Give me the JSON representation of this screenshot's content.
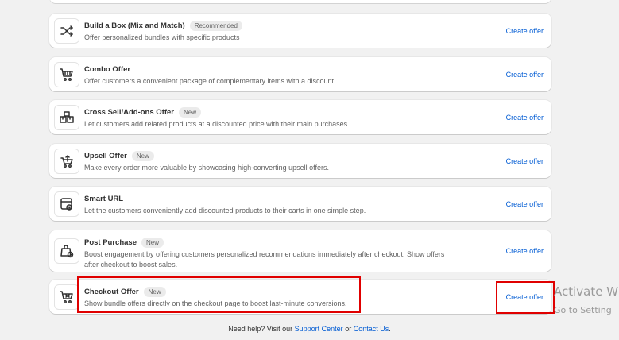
{
  "offers": [
    {
      "title": "Build a Box (Mix and Match)",
      "badge": "Recommended",
      "description": "Offer personalized bundles with specific products",
      "cta": "Create offer",
      "icon": "shuffle-icon"
    },
    {
      "title": "Combo Offer",
      "badge": "",
      "description": "Offer customers a convenient package of complementary items with a discount.",
      "cta": "Create offer",
      "icon": "cart-icon"
    },
    {
      "title": "Cross Sell/Add-ons Offer",
      "badge": "New",
      "description": "Let customers add related products at a discounted price with their main purchases.",
      "cta": "Create offer",
      "icon": "boxes-icon"
    },
    {
      "title": "Upsell Offer",
      "badge": "New",
      "description": "Make every order more valuable by showcasing high-converting upsell offers.",
      "cta": "Create offer",
      "icon": "upsell-cart-icon"
    },
    {
      "title": "Smart URL",
      "badge": "",
      "description": "Let the customers conveniently add discounted products to their carts in one simple step.",
      "cta": "Create offer",
      "icon": "link-window-icon"
    },
    {
      "title": "Post Purchase",
      "badge": "New",
      "description": "Boost engagement by offering customers personalized recommendations immediately after checkout. Show offers after checkout to boost sales.",
      "cta": "Create offer",
      "icon": "bag-clock-icon"
    },
    {
      "title": "Checkout Offer",
      "badge": "New",
      "description": "Show bundle offers directly on the checkout page to boost last-minute conversions.",
      "cta": "Create offer",
      "icon": "checkout-cart-icon"
    }
  ],
  "footer": {
    "prefix": "Need help? Visit our",
    "support_link": "Support Center",
    "or": "or",
    "contact_link": "Contact Us",
    "suffix": "."
  },
  "watermark": {
    "line1": "Activate W",
    "line2": "Go to Setting"
  },
  "colors": {
    "link": "#005bd3",
    "highlight": "#e00000",
    "background": "#f1f1f1"
  }
}
